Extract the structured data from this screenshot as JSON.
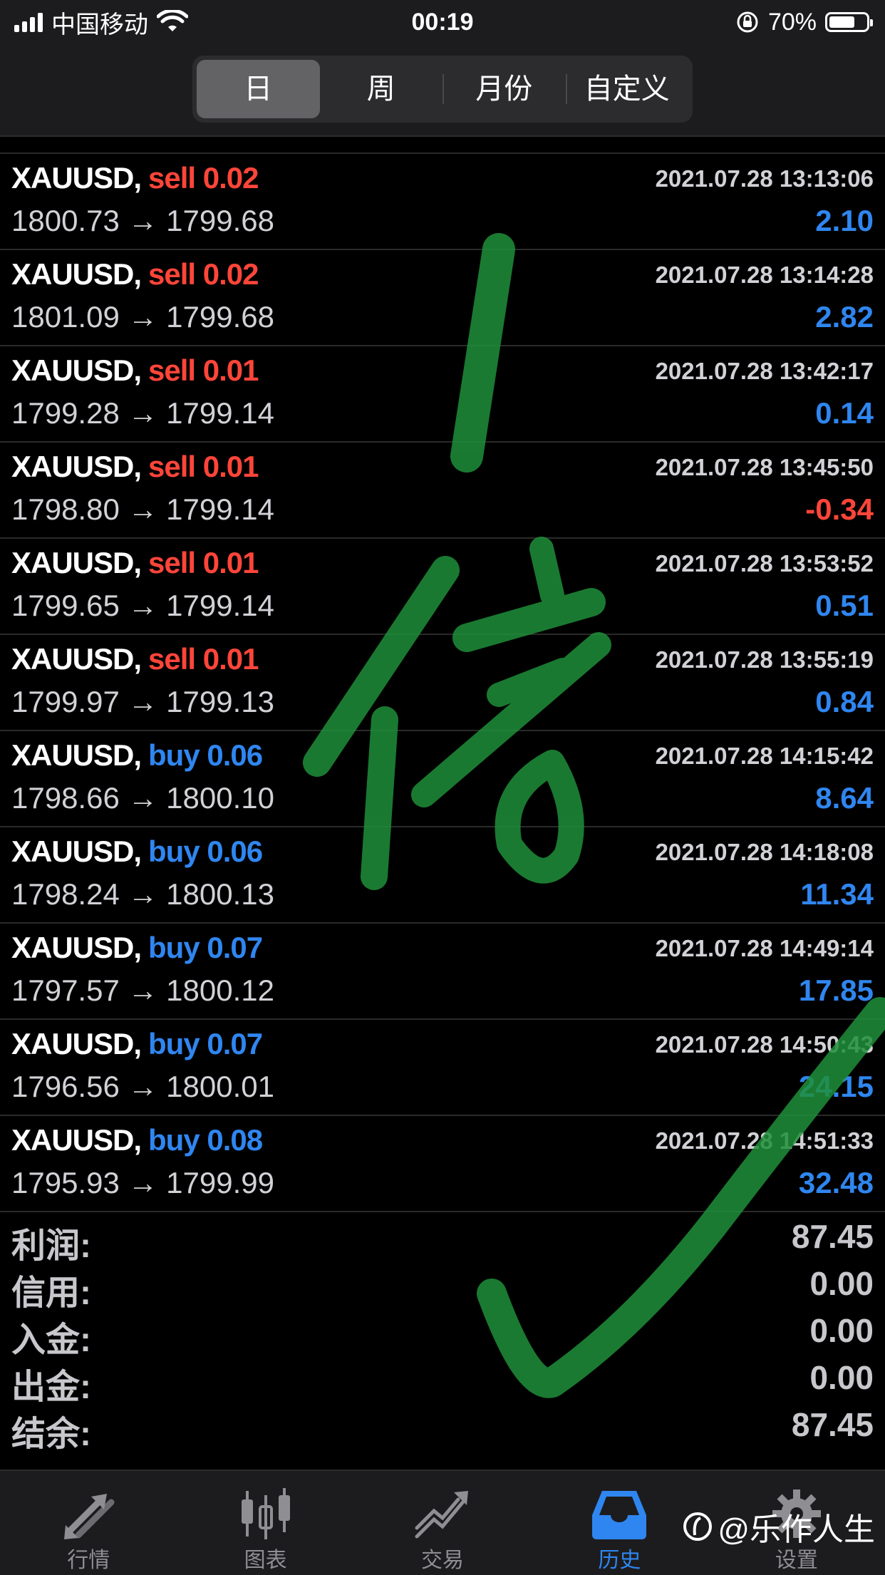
{
  "status_bar": {
    "carrier": "中国移动",
    "time": "00:19",
    "battery": "70%",
    "battery_level": 0.7
  },
  "tabs": [
    {
      "label": "日",
      "active": true
    },
    {
      "label": "周",
      "active": false
    },
    {
      "label": "月份",
      "active": false
    },
    {
      "label": "自定义",
      "active": false
    }
  ],
  "trades": [
    {
      "symbol": "XAUUSD,",
      "side": "sell",
      "type": "sell 0.02",
      "time": "2021.07.28 13:13:06",
      "prices": "1800.73 → 1799.68",
      "profit": "2.10",
      "sign": "pos"
    },
    {
      "symbol": "XAUUSD,",
      "side": "sell",
      "type": "sell 0.02",
      "time": "2021.07.28 13:14:28",
      "prices": "1801.09 → 1799.68",
      "profit": "2.82",
      "sign": "pos"
    },
    {
      "symbol": "XAUUSD,",
      "side": "sell",
      "type": "sell 0.01",
      "time": "2021.07.28 13:42:17",
      "prices": "1799.28 → 1799.14",
      "profit": "0.14",
      "sign": "pos"
    },
    {
      "symbol": "XAUUSD,",
      "side": "sell",
      "type": "sell 0.01",
      "time": "2021.07.28 13:45:50",
      "prices": "1798.80 → 1799.14",
      "profit": "-0.34",
      "sign": "neg"
    },
    {
      "symbol": "XAUUSD,",
      "side": "sell",
      "type": "sell 0.01",
      "time": "2021.07.28 13:53:52",
      "prices": "1799.65 → 1799.14",
      "profit": "0.51",
      "sign": "pos"
    },
    {
      "symbol": "XAUUSD,",
      "side": "sell",
      "type": "sell 0.01",
      "time": "2021.07.28 13:55:19",
      "prices": "1799.97 → 1799.13",
      "profit": "0.84",
      "sign": "pos"
    },
    {
      "symbol": "XAUUSD,",
      "side": "buy",
      "type": "buy 0.06",
      "time": "2021.07.28 14:15:42",
      "prices": "1798.66 → 1800.10",
      "profit": "8.64",
      "sign": "pos"
    },
    {
      "symbol": "XAUUSD,",
      "side": "buy",
      "type": "buy 0.06",
      "time": "2021.07.28 14:18:08",
      "prices": "1798.24 → 1800.13",
      "profit": "11.34",
      "sign": "pos"
    },
    {
      "symbol": "XAUUSD,",
      "side": "buy",
      "type": "buy 0.07",
      "time": "2021.07.28 14:49:14",
      "prices": "1797.57 → 1800.12",
      "profit": "17.85",
      "sign": "pos"
    },
    {
      "symbol": "XAUUSD,",
      "side": "buy",
      "type": "buy 0.07",
      "time": "2021.07.28 14:50:43",
      "prices": "1796.56 → 1800.01",
      "profit": "24.15",
      "sign": "pos"
    },
    {
      "symbol": "XAUUSD,",
      "side": "buy",
      "type": "buy 0.08",
      "time": "2021.07.28 14:51:33",
      "prices": "1795.93 → 1799.99",
      "profit": "32.48",
      "sign": "pos"
    }
  ],
  "summary": [
    {
      "label": "利润:",
      "value": "87.45"
    },
    {
      "label": "信用:",
      "value": "0.00"
    },
    {
      "label": "入金:",
      "value": "0.00"
    },
    {
      "label": "出金:",
      "value": "0.00"
    },
    {
      "label": "结余:",
      "value": "87.45"
    }
  ],
  "tabbar": [
    {
      "label": "行情",
      "icon": "arrows-quotes-icon",
      "active": false
    },
    {
      "label": "图表",
      "icon": "candlestick-chart-icon",
      "active": false
    },
    {
      "label": "交易",
      "icon": "trend-line-icon",
      "active": false
    },
    {
      "label": "历史",
      "icon": "inbox-tray-icon",
      "active": true
    },
    {
      "label": "设置",
      "icon": "gear-icon",
      "active": false
    }
  ],
  "watermark": {
    "handwriting": "1倍",
    "credit": "@乐作人生"
  },
  "colors": {
    "sell": "#ff453a",
    "buy": "#2f86f0",
    "background": "#000000",
    "bar": "#1c1c1e",
    "brush": "#1f8f3a"
  }
}
